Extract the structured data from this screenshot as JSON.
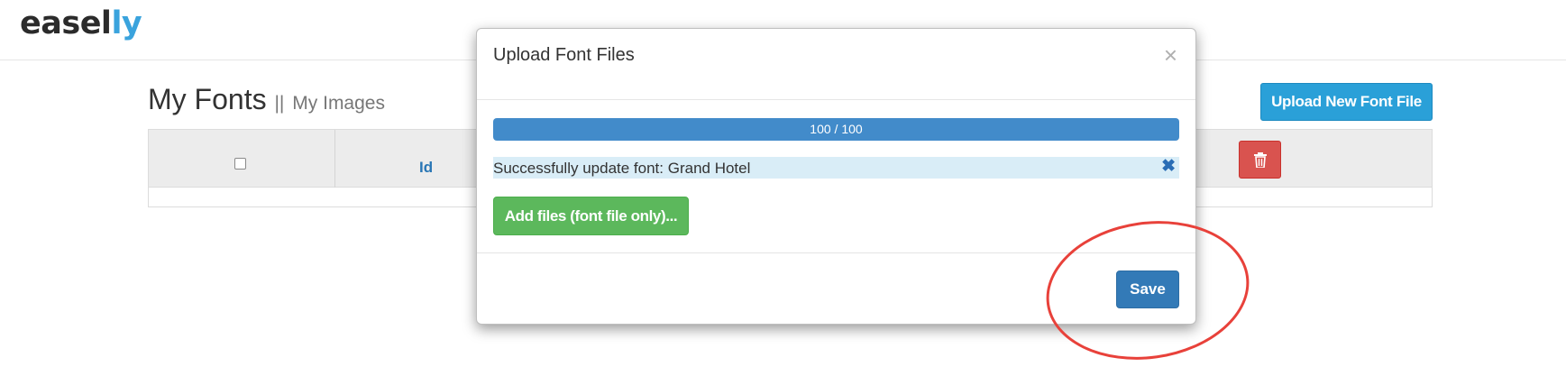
{
  "header": {
    "logo_main": "easel",
    "logo_accent": "ly"
  },
  "page": {
    "title": "My Fonts",
    "separator": "||",
    "images_link": "My Images",
    "upload_button": "Upload New Font File"
  },
  "table": {
    "columns": [
      "",
      "Id"
    ]
  },
  "modal": {
    "title": "Upload Font Files",
    "close_symbol": "×",
    "progress": {
      "label": "100 / 100",
      "value": 1.0
    },
    "message": "Successfully update font: Grand Hotel",
    "message_close": "✖",
    "add_files_button": "Add files (font file only)...",
    "save_button": "Save"
  },
  "colors": {
    "accent": "#3aa3dd",
    "primary": "#337ab7",
    "info_button": "#2aa0d8",
    "success": "#5cb85c",
    "danger": "#d9534f",
    "annotation": "#e8413a"
  },
  "icons": [
    "trash-icon",
    "close-icon",
    "remove-icon"
  ]
}
